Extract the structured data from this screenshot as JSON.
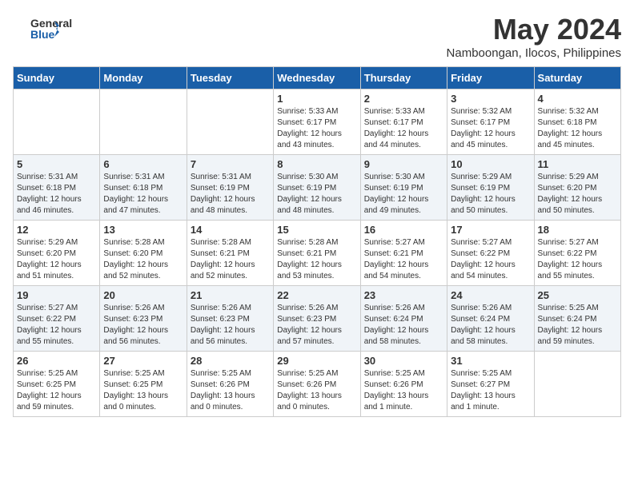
{
  "logo": {
    "line1": "General",
    "line2": "Blue"
  },
  "title": "May 2024",
  "location": "Namboongan, Ilocos, Philippines",
  "weekdays": [
    "Sunday",
    "Monday",
    "Tuesday",
    "Wednesday",
    "Thursday",
    "Friday",
    "Saturday"
  ],
  "weeks": [
    [
      {
        "day": "",
        "info": ""
      },
      {
        "day": "",
        "info": ""
      },
      {
        "day": "",
        "info": ""
      },
      {
        "day": "1",
        "info": "Sunrise: 5:33 AM\nSunset: 6:17 PM\nDaylight: 12 hours\nand 43 minutes."
      },
      {
        "day": "2",
        "info": "Sunrise: 5:33 AM\nSunset: 6:17 PM\nDaylight: 12 hours\nand 44 minutes."
      },
      {
        "day": "3",
        "info": "Sunrise: 5:32 AM\nSunset: 6:17 PM\nDaylight: 12 hours\nand 45 minutes."
      },
      {
        "day": "4",
        "info": "Sunrise: 5:32 AM\nSunset: 6:18 PM\nDaylight: 12 hours\nand 45 minutes."
      }
    ],
    [
      {
        "day": "5",
        "info": "Sunrise: 5:31 AM\nSunset: 6:18 PM\nDaylight: 12 hours\nand 46 minutes."
      },
      {
        "day": "6",
        "info": "Sunrise: 5:31 AM\nSunset: 6:18 PM\nDaylight: 12 hours\nand 47 minutes."
      },
      {
        "day": "7",
        "info": "Sunrise: 5:31 AM\nSunset: 6:19 PM\nDaylight: 12 hours\nand 48 minutes."
      },
      {
        "day": "8",
        "info": "Sunrise: 5:30 AM\nSunset: 6:19 PM\nDaylight: 12 hours\nand 48 minutes."
      },
      {
        "day": "9",
        "info": "Sunrise: 5:30 AM\nSunset: 6:19 PM\nDaylight: 12 hours\nand 49 minutes."
      },
      {
        "day": "10",
        "info": "Sunrise: 5:29 AM\nSunset: 6:19 PM\nDaylight: 12 hours\nand 50 minutes."
      },
      {
        "day": "11",
        "info": "Sunrise: 5:29 AM\nSunset: 6:20 PM\nDaylight: 12 hours\nand 50 minutes."
      }
    ],
    [
      {
        "day": "12",
        "info": "Sunrise: 5:29 AM\nSunset: 6:20 PM\nDaylight: 12 hours\nand 51 minutes."
      },
      {
        "day": "13",
        "info": "Sunrise: 5:28 AM\nSunset: 6:20 PM\nDaylight: 12 hours\nand 52 minutes."
      },
      {
        "day": "14",
        "info": "Sunrise: 5:28 AM\nSunset: 6:21 PM\nDaylight: 12 hours\nand 52 minutes."
      },
      {
        "day": "15",
        "info": "Sunrise: 5:28 AM\nSunset: 6:21 PM\nDaylight: 12 hours\nand 53 minutes."
      },
      {
        "day": "16",
        "info": "Sunrise: 5:27 AM\nSunset: 6:21 PM\nDaylight: 12 hours\nand 54 minutes."
      },
      {
        "day": "17",
        "info": "Sunrise: 5:27 AM\nSunset: 6:22 PM\nDaylight: 12 hours\nand 54 minutes."
      },
      {
        "day": "18",
        "info": "Sunrise: 5:27 AM\nSunset: 6:22 PM\nDaylight: 12 hours\nand 55 minutes."
      }
    ],
    [
      {
        "day": "19",
        "info": "Sunrise: 5:27 AM\nSunset: 6:22 PM\nDaylight: 12 hours\nand 55 minutes."
      },
      {
        "day": "20",
        "info": "Sunrise: 5:26 AM\nSunset: 6:23 PM\nDaylight: 12 hours\nand 56 minutes."
      },
      {
        "day": "21",
        "info": "Sunrise: 5:26 AM\nSunset: 6:23 PM\nDaylight: 12 hours\nand 56 minutes."
      },
      {
        "day": "22",
        "info": "Sunrise: 5:26 AM\nSunset: 6:23 PM\nDaylight: 12 hours\nand 57 minutes."
      },
      {
        "day": "23",
        "info": "Sunrise: 5:26 AM\nSunset: 6:24 PM\nDaylight: 12 hours\nand 58 minutes."
      },
      {
        "day": "24",
        "info": "Sunrise: 5:26 AM\nSunset: 6:24 PM\nDaylight: 12 hours\nand 58 minutes."
      },
      {
        "day": "25",
        "info": "Sunrise: 5:25 AM\nSunset: 6:24 PM\nDaylight: 12 hours\nand 59 minutes."
      }
    ],
    [
      {
        "day": "26",
        "info": "Sunrise: 5:25 AM\nSunset: 6:25 PM\nDaylight: 12 hours\nand 59 minutes."
      },
      {
        "day": "27",
        "info": "Sunrise: 5:25 AM\nSunset: 6:25 PM\nDaylight: 13 hours\nand 0 minutes."
      },
      {
        "day": "28",
        "info": "Sunrise: 5:25 AM\nSunset: 6:26 PM\nDaylight: 13 hours\nand 0 minutes."
      },
      {
        "day": "29",
        "info": "Sunrise: 5:25 AM\nSunset: 6:26 PM\nDaylight: 13 hours\nand 0 minutes."
      },
      {
        "day": "30",
        "info": "Sunrise: 5:25 AM\nSunset: 6:26 PM\nDaylight: 13 hours\nand 1 minute."
      },
      {
        "day": "31",
        "info": "Sunrise: 5:25 AM\nSunset: 6:27 PM\nDaylight: 13 hours\nand 1 minute."
      },
      {
        "day": "",
        "info": ""
      }
    ]
  ]
}
